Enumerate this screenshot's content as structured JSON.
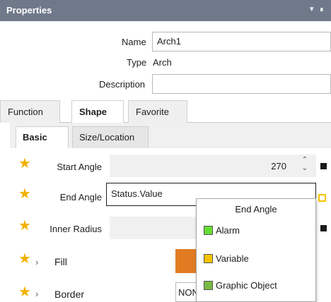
{
  "panel": {
    "title": "Properties"
  },
  "header": {
    "name_label": "Name",
    "name_value": "Arch1",
    "type_label": "Type",
    "type_value": "Arch",
    "description_label": "Description",
    "description_value": ""
  },
  "top_tabs": [
    {
      "label": "Function",
      "active": false
    },
    {
      "label": "Shape",
      "active": true
    },
    {
      "label": "Favorite",
      "active": false
    }
  ],
  "sub_tabs": [
    {
      "label": "Basic",
      "active": true
    },
    {
      "label": "Size/Location",
      "active": false
    }
  ],
  "properties": {
    "start_angle": {
      "label": "Start Angle",
      "value": "270"
    },
    "end_angle": {
      "label": "End Angle",
      "value": "Status.Value"
    },
    "inner_radius": {
      "label": "Inner Radius",
      "value": ""
    },
    "fill": {
      "label": "Fill",
      "color": "#e07b22"
    },
    "border": {
      "label": "Border",
      "value": "NON"
    }
  },
  "dropdown": {
    "header": "End Angle",
    "items": [
      {
        "label": "Alarm",
        "color": "#66dd33"
      },
      {
        "label": "Variable",
        "color": "#f5c400"
      },
      {
        "label": "Graphic Object",
        "color": "#77bb44"
      }
    ]
  },
  "colors": {
    "titlebar": "#70798a",
    "star": "#f2b100",
    "accent_box": "#f5c400"
  }
}
